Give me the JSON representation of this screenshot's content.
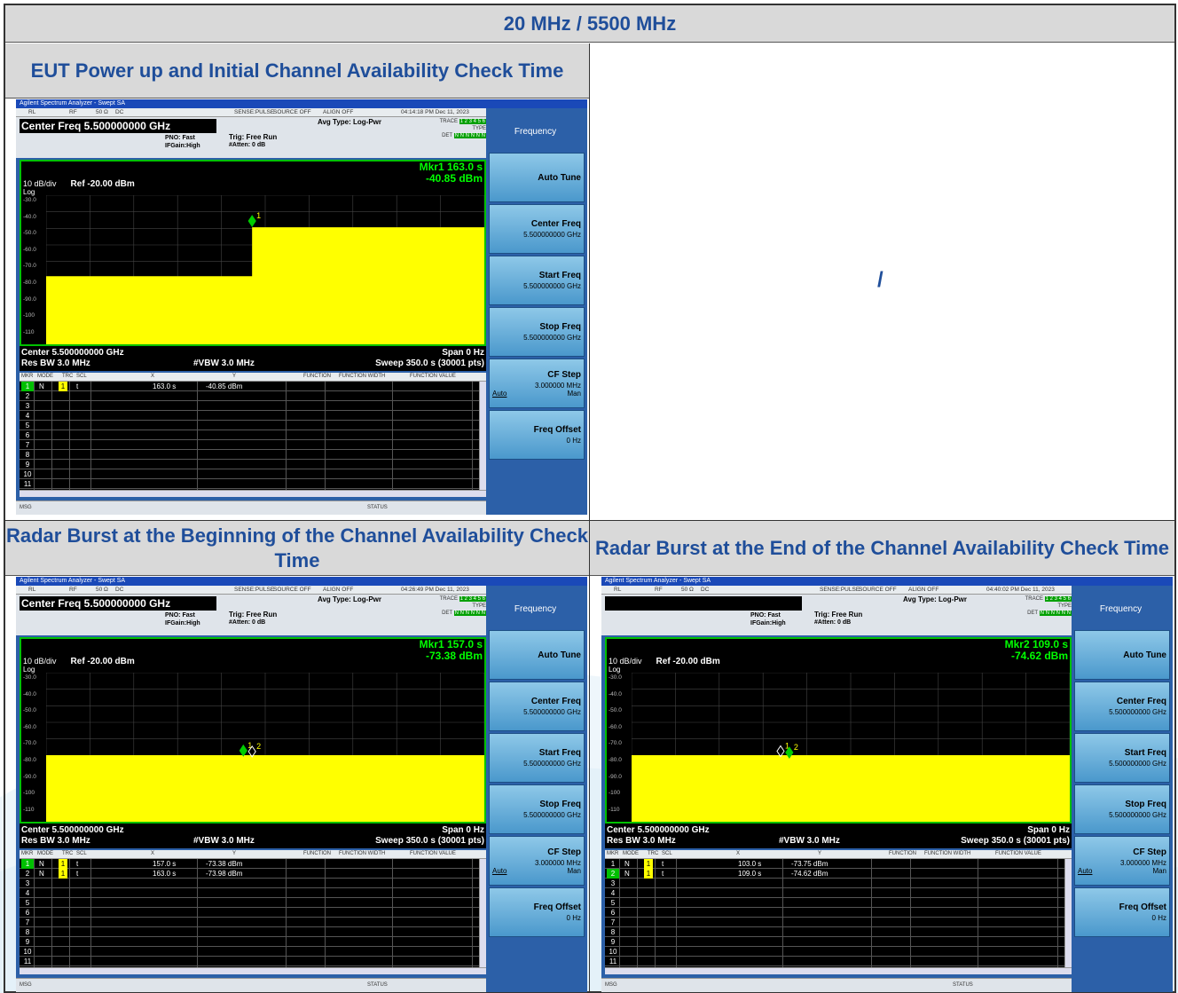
{
  "header_title": "20 MHz / 5500 MHz",
  "cells": {
    "top_left_title": "EUT Power up and Initial Channel Availability Check Time",
    "top_right_text": "/",
    "bottom_left_title": "Radar Burst at the Beginning of the Channel Availability Check Time",
    "bottom_right_title": "Radar Burst at the End of the Channel Availability Check Time"
  },
  "colors": {
    "title_blue": "#1f4e9a",
    "cell_gray": "#d9d9d9",
    "trace_yellow": "#ffff00",
    "marker_green": "#00ff00"
  },
  "analyzers": [
    {
      "window_title": "Agilent Spectrum Analyzer - Swept SA",
      "status_strip": {
        "rl": "RL",
        "rf": "RF",
        "ohm": "50 Ω",
        "dc": "DC",
        "sense": "SENSE:PULSE",
        "source": "SOURCE OFF",
        "align": "ALIGN OFF",
        "time": "04:14:18 PM Dec 11, 2023"
      },
      "center_freq_banner": "Center Freq 5.500000000 GHz",
      "pno": "PNO: Fast",
      "ifgain": "IFGain:High",
      "trig": "Trig: Free Run",
      "atten": "#Atten: 0 dB",
      "avg_type": "Avg Type: Log-Pwr",
      "trace_label": "TRACE",
      "trace_nums": "1 2 3 4 5 6",
      "type_label": "TYPE",
      "det_label": "DET",
      "det_val": "N N N N N N",
      "marker_readout_1": "Mkr1 163.0 s",
      "marker_readout_2": "-40.85 dBm",
      "scale": "10 dB/div",
      "ref_level": "Ref -20.00 dBm",
      "log": "Log",
      "y_ticks": [
        "-30.0",
        "-40.0",
        "-50.0",
        "-60.0",
        "-70.0",
        "-80.0",
        "-90.0",
        "-100",
        "-110"
      ],
      "center": "Center 5.500000000 GHz",
      "span": "Span 0 Hz",
      "res_bw": "Res BW 3.0 MHz",
      "vbw": "#VBW 3.0 MHz",
      "sweep": "Sweep  350.0 s (30001 pts)",
      "marker_table_header": [
        "MKR",
        "MODE",
        "TRC",
        "SCL",
        "X",
        "Y",
        "FUNCTION",
        "FUNCTION WIDTH",
        "FUNCTION VALUE"
      ],
      "marker_rows": [
        {
          "idx": "1",
          "mode": "N",
          "trc": "1",
          "scl": "t",
          "x": "163.0 s",
          "y": "-40.85 dBm"
        }
      ],
      "row_numbers": [
        "1",
        "2",
        "3",
        "4",
        "5",
        "6",
        "7",
        "8",
        "9",
        "10",
        "11"
      ],
      "active_row": 0,
      "msg": "MSG",
      "status": "STATUS",
      "softkeys": {
        "menu": "Frequency",
        "auto_tune": "Auto Tune",
        "center_freq": "Center Freq",
        "center_freq_val": "5.500000000 GHz",
        "start_freq": "Start Freq",
        "start_freq_val": "5.500000000 GHz",
        "stop_freq": "Stop Freq",
        "stop_freq_val": "5.500000000 GHz",
        "cf_step": "CF Step",
        "cf_step_val": "3.000000 MHz",
        "auto": "Auto",
        "man": "Man",
        "freq_offset": "Freq Offset",
        "freq_offset_val": "0 Hz"
      },
      "trace_shape": "step",
      "markers": [
        {
          "label": "1",
          "x_frac": 0.47,
          "level": -40.85,
          "filled": true
        }
      ]
    },
    {
      "window_title": "Agilent Spectrum Analyzer - Swept SA",
      "status_strip": {
        "rl": "RL",
        "rf": "RF",
        "ohm": "50 Ω",
        "dc": "DC",
        "sense": "SENSE:PULSE",
        "source": "SOURCE OFF",
        "align": "ALIGN OFF",
        "time": "04:26:49 PM Dec 11, 2023"
      },
      "center_freq_banner": "Center Freq 5.500000000 GHz",
      "pno": "PNO: Fast",
      "ifgain": "IFGain:High",
      "trig": "Trig: Free Run",
      "atten": "#Atten: 0 dB",
      "avg_type": "Avg Type: Log-Pwr",
      "trace_label": "TRACE",
      "trace_nums": "1 2 3 4 5 6",
      "type_label": "TYPE",
      "det_label": "DET",
      "det_val": "N N N N N N",
      "marker_readout_1": "Mkr1 157.0 s",
      "marker_readout_2": "-73.38 dBm",
      "scale": "10 dB/div",
      "ref_level": "Ref -20.00 dBm",
      "log": "Log",
      "y_ticks": [
        "-30.0",
        "-40.0",
        "-50.0",
        "-60.0",
        "-70.0",
        "-80.0",
        "-90.0",
        "-100",
        "-110"
      ],
      "center": "Center 5.500000000 GHz",
      "span": "Span 0 Hz",
      "res_bw": "Res BW 3.0 MHz",
      "vbw": "#VBW 3.0 MHz",
      "sweep": "Sweep  350.0 s (30001 pts)",
      "marker_table_header": [
        "MKR",
        "MODE",
        "TRC",
        "SCL",
        "X",
        "Y",
        "FUNCTION",
        "FUNCTION WIDTH",
        "FUNCTION VALUE"
      ],
      "marker_rows": [
        {
          "idx": "1",
          "mode": "N",
          "trc": "1",
          "scl": "t",
          "x": "157.0 s",
          "y": "-73.38 dBm"
        },
        {
          "idx": "2",
          "mode": "N",
          "trc": "1",
          "scl": "t",
          "x": "163.0 s",
          "y": "-73.98 dBm"
        }
      ],
      "row_numbers": [
        "1",
        "2",
        "3",
        "4",
        "5",
        "6",
        "7",
        "8",
        "9",
        "10",
        "11"
      ],
      "active_row": 0,
      "msg": "MSG",
      "status": "STATUS",
      "softkeys": {
        "menu": "Frequency",
        "auto_tune": "Auto Tune",
        "center_freq": "Center Freq",
        "center_freq_val": "5.500000000 GHz",
        "start_freq": "Start Freq",
        "start_freq_val": "5.500000000 GHz",
        "stop_freq": "Stop Freq",
        "stop_freq_val": "5.500000000 GHz",
        "cf_step": "CF Step",
        "cf_step_val": "3.000000 MHz",
        "auto": "Auto",
        "man": "Man",
        "freq_offset": "Freq Offset",
        "freq_offset_val": "0 Hz"
      },
      "trace_shape": "flat",
      "markers": [
        {
          "label": "1",
          "x_frac": 0.45,
          "level": -73.38,
          "filled": true
        },
        {
          "label": "2",
          "x_frac": 0.47,
          "level": -73.98,
          "filled": false
        }
      ]
    },
    {
      "window_title": "Agilent Spectrum Analyzer - Swept SA",
      "status_strip": {
        "rl": "RL",
        "rf": "RF",
        "ohm": "50 Ω",
        "dc": "DC",
        "sense": "SENSE:PULSE",
        "source": "SOURCE OFF",
        "align": "ALIGN OFF",
        "time": "04:40:02 PM Dec 11, 2023"
      },
      "center_freq_banner": "",
      "pno": "PNO: Fast",
      "ifgain": "IFGain:High",
      "trig": "Trig: Free Run",
      "atten": "#Atten: 0 dB",
      "avg_type": "Avg Type: Log-Pwr",
      "trace_label": "TRACE",
      "trace_nums": "1 2 3 4 5 6",
      "type_label": "TYPE",
      "det_label": "DET",
      "det_val": "N N N N N N",
      "marker_readout_1": "Mkr2 109.0 s",
      "marker_readout_2": "-74.62 dBm",
      "scale": "10 dB/div",
      "ref_level": "Ref -20.00 dBm",
      "log": "Log",
      "y_ticks": [
        "-30.0",
        "-40.0",
        "-50.0",
        "-60.0",
        "-70.0",
        "-80.0",
        "-90.0",
        "-100",
        "-110"
      ],
      "center": "Center 5.500000000 GHz",
      "span": "Span 0 Hz",
      "res_bw": "Res BW 3.0 MHz",
      "vbw": "#VBW 3.0 MHz",
      "sweep": "Sweep  350.0 s (30001 pts)",
      "marker_table_header": [
        "MKR",
        "MODE",
        "TRC",
        "SCL",
        "X",
        "Y",
        "FUNCTION",
        "FUNCTION WIDTH",
        "FUNCTION VALUE"
      ],
      "marker_rows": [
        {
          "idx": "1",
          "mode": "N",
          "trc": "1",
          "scl": "t",
          "x": "103.0 s",
          "y": "-73.75 dBm"
        },
        {
          "idx": "2",
          "mode": "N",
          "trc": "1",
          "scl": "t",
          "x": "109.0 s",
          "y": "-74.62 dBm"
        }
      ],
      "row_numbers": [
        "1",
        "2",
        "3",
        "4",
        "5",
        "6",
        "7",
        "8",
        "9",
        "10",
        "11"
      ],
      "active_row": 1,
      "msg": "MSG",
      "status": "STATUS",
      "softkeys": {
        "menu": "Frequency",
        "auto_tune": "Auto Tune",
        "center_freq": "Center Freq",
        "center_freq_val": "5.500000000 GHz",
        "start_freq": "Start Freq",
        "start_freq_val": "5.500000000 GHz",
        "stop_freq": "Stop Freq",
        "stop_freq_val": "5.500000000 GHz",
        "cf_step": "CF Step",
        "cf_step_val": "3.000000 MHz",
        "auto": "Auto",
        "man": "Man",
        "freq_offset": "Freq Offset",
        "freq_offset_val": "0 Hz"
      },
      "trace_shape": "flat",
      "markers": [
        {
          "label": "1",
          "x_frac": 0.34,
          "level": -73.75,
          "filled": false
        },
        {
          "label": "2",
          "x_frac": 0.36,
          "level": -74.62,
          "filled": true
        }
      ]
    }
  ]
}
